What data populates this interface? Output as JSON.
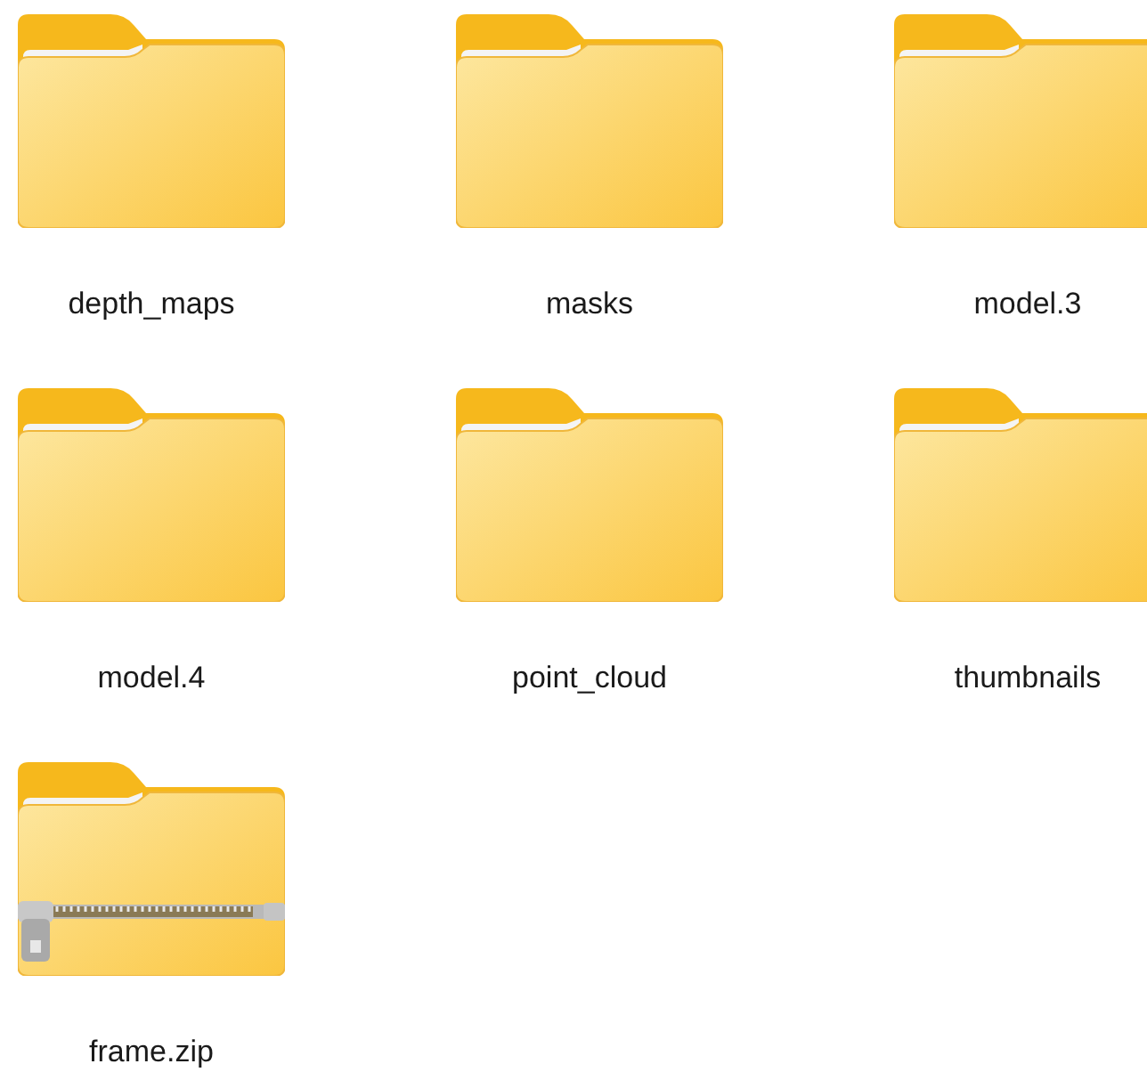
{
  "items": [
    {
      "name": "depth_maps",
      "kind": "folder"
    },
    {
      "name": "masks",
      "kind": "folder"
    },
    {
      "name": "model.3",
      "kind": "folder"
    },
    {
      "name": "model.4",
      "kind": "folder"
    },
    {
      "name": "point_cloud",
      "kind": "folder"
    },
    {
      "name": "thumbnails",
      "kind": "folder"
    },
    {
      "name": "frame.zip",
      "kind": "zip"
    }
  ]
}
